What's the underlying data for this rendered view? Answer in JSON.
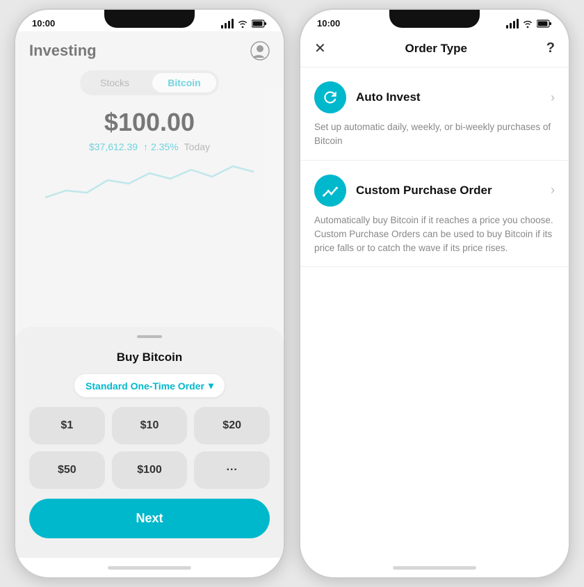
{
  "leftPhone": {
    "statusBar": {
      "time": "10:00"
    },
    "header": {
      "title": "Investing"
    },
    "tabs": [
      {
        "label": "Stocks",
        "active": false
      },
      {
        "label": "Bitcoin",
        "active": true
      }
    ],
    "price": "$100.00",
    "priceDetail": "$37,612.39",
    "change": "↑ 2.35%",
    "period": "Today",
    "bottomSheet": {
      "title": "Buy Bitcoin",
      "orderType": "Standard One-Time Order",
      "amounts": [
        "$1",
        "$10",
        "$20",
        "$50",
        "$100",
        "···"
      ],
      "nextLabel": "Next"
    }
  },
  "rightPhone": {
    "statusBar": {
      "time": "10:00"
    },
    "header": {
      "title": "Order Type",
      "closeLabel": "✕",
      "helpLabel": "?"
    },
    "options": [
      {
        "name": "Auto Invest",
        "description": "Set up automatic daily, weekly, or bi-weekly purchases of Bitcoin",
        "iconType": "refresh"
      },
      {
        "name": "Custom Purchase Order",
        "description": "Automatically buy Bitcoin if it reaches a price you choose. Custom Purchase Orders can be used to buy Bitcoin if its price falls or to catch the wave if its price rises.",
        "iconType": "chart"
      }
    ]
  }
}
